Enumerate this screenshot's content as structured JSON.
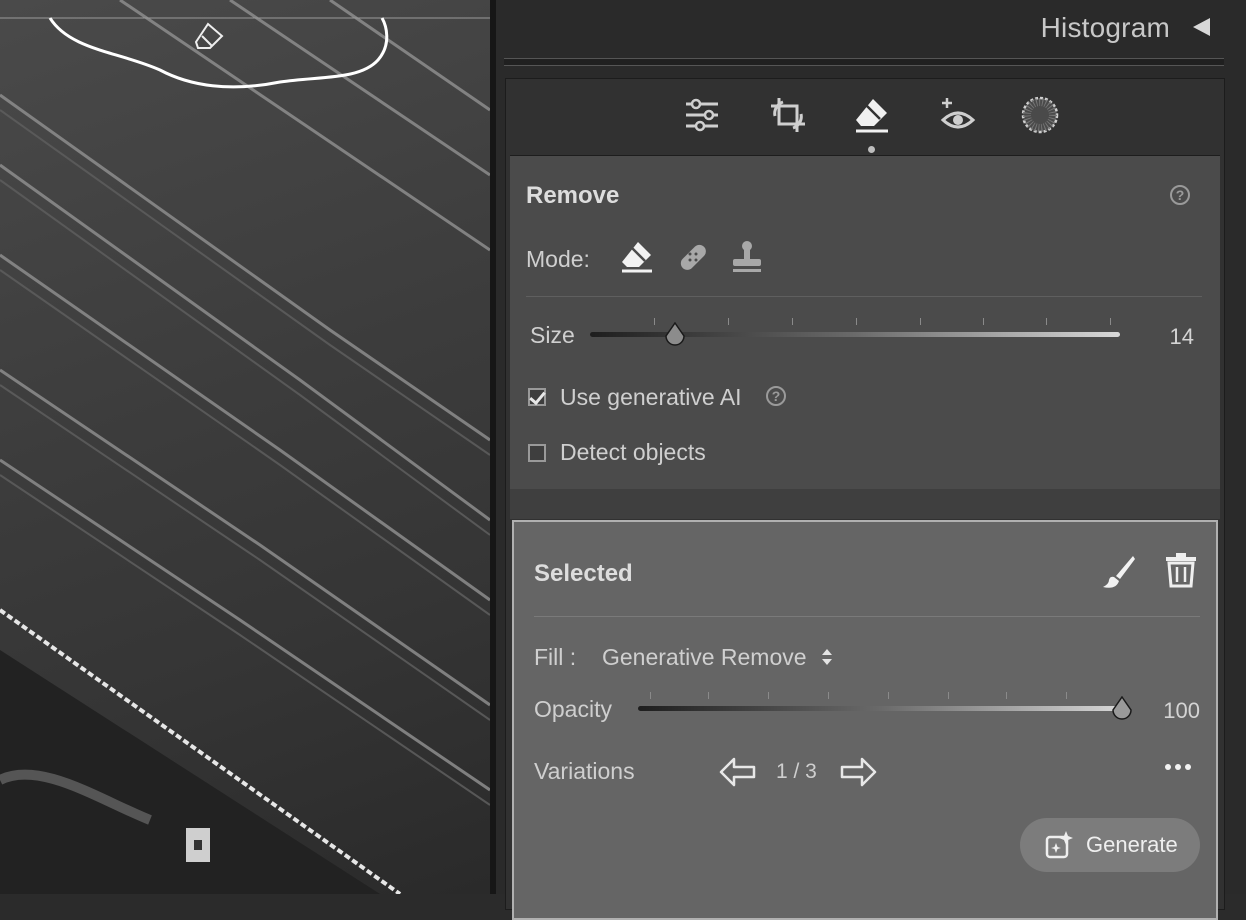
{
  "panel": {
    "histogram_title": "Histogram",
    "tools": [
      {
        "name": "edit-sliders-icon",
        "active": false
      },
      {
        "name": "crop-icon",
        "active": false
      },
      {
        "name": "remove-eraser-icon",
        "active": true
      },
      {
        "name": "red-eye-icon",
        "active": false
      },
      {
        "name": "masking-icon",
        "active": false
      }
    ]
  },
  "remove": {
    "title": "Remove",
    "mode_label": "Mode:",
    "modes": [
      "remove-eraser-icon",
      "heal-bandage-icon",
      "clone-stamp-icon"
    ],
    "size_label": "Size",
    "size_value": "14",
    "size_fraction": 0.16,
    "use_ai_label": "Use generative AI",
    "use_ai_checked": true,
    "detect_label": "Detect objects",
    "detect_checked": false
  },
  "selected": {
    "title": "Selected",
    "fill_label": "Fill :",
    "fill_value": "Generative Remove",
    "opacity_label": "Opacity",
    "opacity_value": "100",
    "opacity_fraction": 1.0,
    "variations_label": "Variations",
    "variations_counter": "1 / 3",
    "generate_label": "Generate"
  },
  "colors": {
    "panel_bg": "#2a2a2a",
    "remove_bg": "#4b4b4b",
    "selected_bg": "#656565",
    "accent_text": "#dddddd"
  }
}
